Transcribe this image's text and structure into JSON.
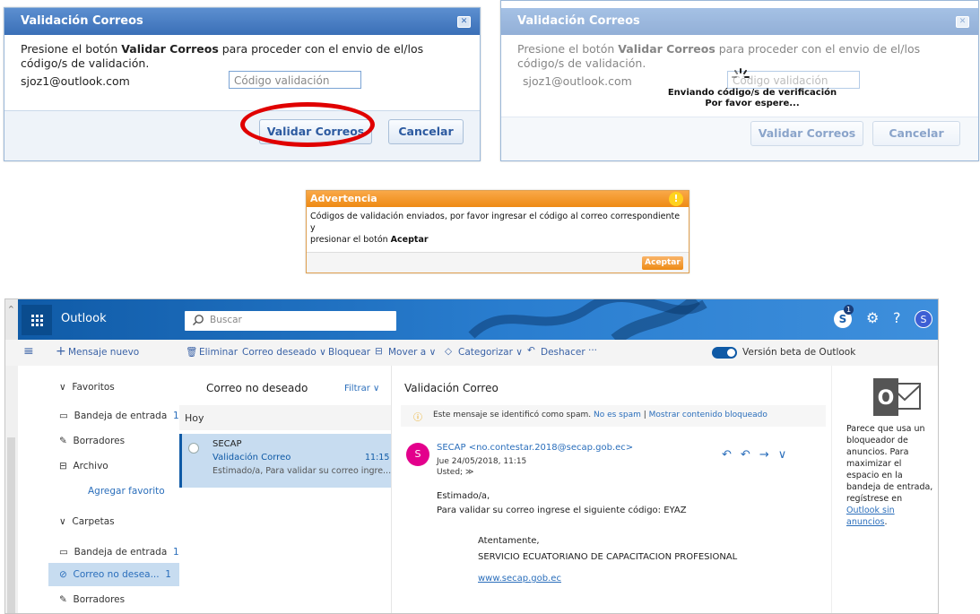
{
  "dialog1": {
    "title": "Validación Correos",
    "msg_pre": "Presione el botón ",
    "msg_bold": "Validar Correos",
    "msg_post": " para proceder con el envio de el/los",
    "msg_line2": "código/s de validación.",
    "email": "sjoz1@outlook.com",
    "code_placeholder": "Código validación",
    "validate_label": "Validar Correos",
    "cancel_label": "Cancelar"
  },
  "dialog2": {
    "title": "Validación Correos",
    "msg_pre": "Presione el botón ",
    "msg_bold": "Validar Correos",
    "msg_post": " para proceder con el envio de el/los",
    "msg_line2": "código/s de validación.",
    "email": "sjoz1@outlook.com",
    "code_placeholder": "Código validación",
    "sending_line1": "Enviando código/s de verificación",
    "sending_line2": "Por favor espere...",
    "validate_label": "Validar Correos",
    "cancel_label": "Cancelar"
  },
  "warning": {
    "title": "Advertencia",
    "icon": "!",
    "msg_line1": "Códigos de validación enviados, por favor ingresar el código al correo correspondiente y",
    "msg_line2_pre": "presionar el botón ",
    "msg_line2_bold": "Aceptar",
    "accept_label": "Aceptar"
  },
  "outlook": {
    "app_name": "Outlook",
    "search_placeholder": "Buscar",
    "notification_count": "1",
    "help_label": "?",
    "avatar_initial": "S",
    "new_message": "Mensaje nuevo",
    "toolbar": {
      "delete": "Eliminar",
      "junk": "Correo deseado",
      "block": "Bloquear",
      "move": "Mover a",
      "categorize": "Categorizar",
      "undo": "Deshacer",
      "more": "···",
      "beta": "Versión beta de Outlook"
    },
    "nav": {
      "favorites": "Favoritos",
      "inbox_fav": "Bandeja de entrada",
      "inbox_fav_count": "1",
      "drafts_fav": "Borradores",
      "archive": "Archivo",
      "add_favorite": "Agregar favorito",
      "folders": "Carpetas",
      "inbox": "Bandeja de entrada",
      "inbox_count": "1",
      "junk": "Correo no desea...",
      "junk_count": "1",
      "drafts": "Borradores"
    },
    "list": {
      "folder_title": "Correo no deseado",
      "filter": "Filtrar",
      "group": "Hoy",
      "item": {
        "sender": "SECAP",
        "subject": "Validación Correo",
        "time": "11:15",
        "preview": "Estimado/a, Para validar su correo ingre..."
      }
    },
    "reading": {
      "subject": "Validación Correo",
      "spam_notice": "Este mensaje se identificó como spam.",
      "not_spam": "No es spam",
      "separator": "|",
      "show_blocked": "Mostrar contenido bloqueado",
      "avatar_initial": "S",
      "from": "SECAP <no.contestar.2018@secap.gob.ec>",
      "date": "Jue 24/05/2018, 11:15",
      "to": "Usted; ≫",
      "greeting": "Estimado/a,",
      "body": "Para validar su correo ingrese el siguiente código: EYAZ",
      "closing": "Atentamente,",
      "org": "SERVICIO ECUATORIANO DE CAPACITACION PROFESIONAL",
      "link": "www.secap.gob.ec"
    },
    "ad": {
      "logo_letter": "O",
      "text": "Parece que usa un bloqueador de anuncios. Para maximizar el espacio en la bandeja de entrada, regístrese en ",
      "link": "Outlook sin anuncios",
      "end": "."
    }
  },
  "colors": {
    "dialog_title": "#3a6fb7",
    "warning_orange": "#ee8a14",
    "outlook_blue": "#0f5aa6",
    "highlight_red": "#e00000",
    "selected_item": "#c7dcf0",
    "spam_pink": "#e3008c"
  }
}
